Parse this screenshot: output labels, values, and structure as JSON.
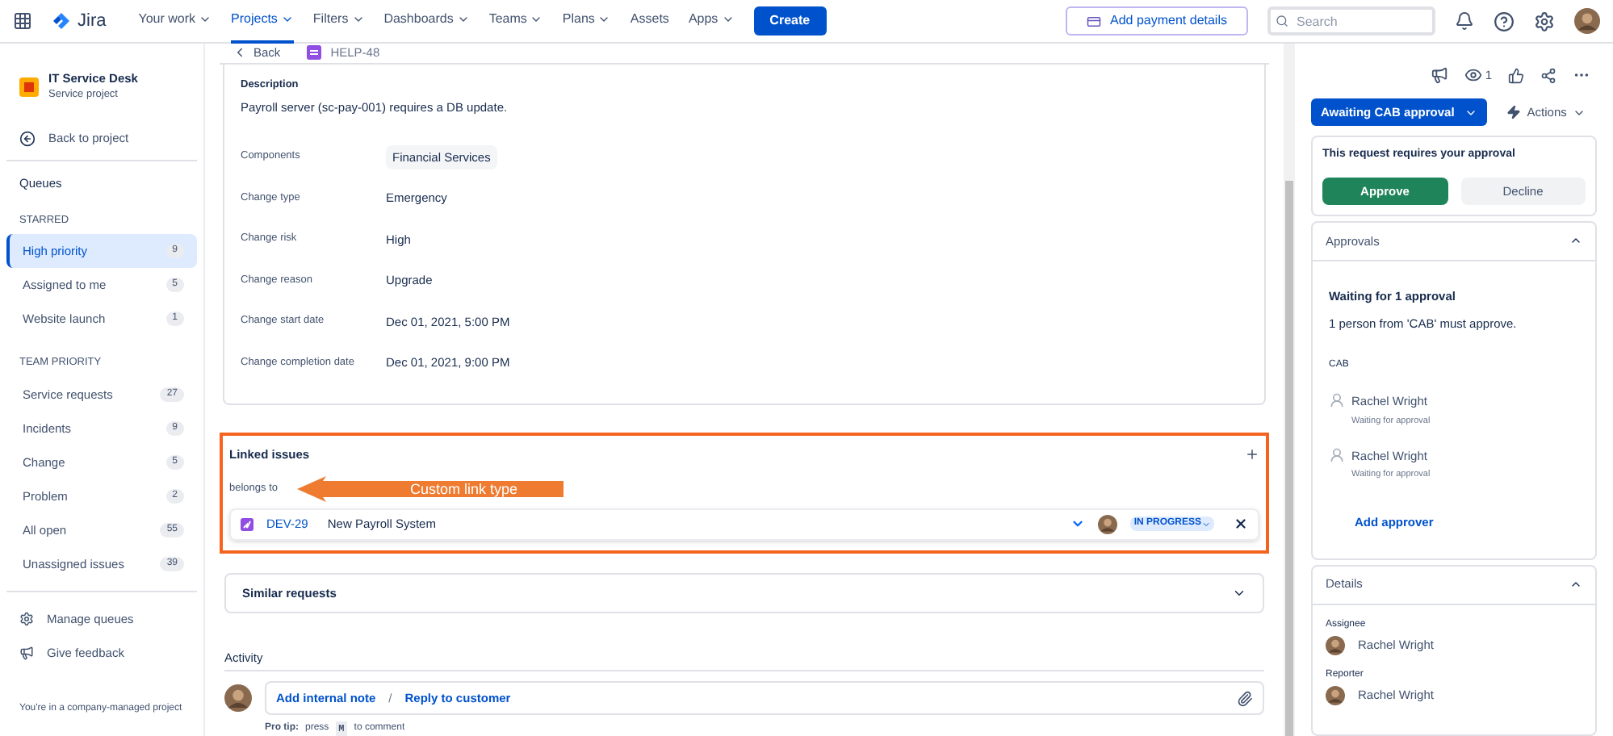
{
  "top_nav": {
    "logo": "Jira",
    "menus": [
      {
        "label": "Your work",
        "selected": false,
        "dropdown": true
      },
      {
        "label": "Projects",
        "selected": true,
        "dropdown": true
      },
      {
        "label": "Filters",
        "selected": false,
        "dropdown": true
      },
      {
        "label": "Dashboards",
        "selected": false,
        "dropdown": true
      },
      {
        "label": "Teams",
        "selected": false,
        "dropdown": true
      },
      {
        "label": "Plans",
        "selected": false,
        "dropdown": true
      },
      {
        "label": "Assets",
        "selected": false,
        "dropdown": false
      },
      {
        "label": "Apps",
        "selected": false,
        "dropdown": true
      }
    ],
    "create": "Create",
    "payment": "Add payment details",
    "search": {
      "placeholder": "Search"
    }
  },
  "sidebar": {
    "project": {
      "name": "IT Service Desk",
      "type": "Service project"
    },
    "back": "Back to project",
    "queues": "Queues",
    "sections": [
      {
        "title": "STARRED",
        "items": [
          {
            "label": "High priority",
            "count": "9",
            "selected": true
          },
          {
            "label": "Assigned to me",
            "count": "5",
            "selected": false
          },
          {
            "label": "Website launch",
            "count": "1",
            "selected": false
          }
        ]
      },
      {
        "title": "TEAM PRIORITY",
        "items": [
          {
            "label": "Service requests",
            "count": "27",
            "selected": false
          },
          {
            "label": "Incidents",
            "count": "9",
            "selected": false
          },
          {
            "label": "Change",
            "count": "5",
            "selected": false
          },
          {
            "label": "Problem",
            "count": "2",
            "selected": false
          },
          {
            "label": "All open",
            "count": "55",
            "selected": false
          },
          {
            "label": "Unassigned issues",
            "count": "39",
            "selected": false
          }
        ]
      }
    ],
    "actions": [
      {
        "kind": "gear",
        "label": "Manage queues"
      },
      {
        "kind": "megaphone",
        "label": "Give feedback"
      }
    ],
    "footer": "You're in a company-managed project"
  },
  "breadcrumb": {
    "back": "Back",
    "issue_key": "HELP-48"
  },
  "description": {
    "label": "Description",
    "text": "Payroll server (sc-pay-001) requires a DB update."
  },
  "fields": [
    {
      "label": "Components",
      "value": "Financial Services",
      "kind": "tag"
    },
    {
      "label": "Change type",
      "value": "Emergency",
      "kind": "text"
    },
    {
      "label": "Change risk",
      "value": "High",
      "kind": "text"
    },
    {
      "label": "Change reason",
      "value": "Upgrade",
      "kind": "text"
    },
    {
      "label": "Change start date",
      "value": "Dec 01, 2021, 5:00 PM",
      "kind": "text"
    },
    {
      "label": "Change completion date",
      "value": "Dec 01, 2021, 9:00 PM",
      "kind": "text"
    }
  ],
  "linked_issues": {
    "title": "Linked issues",
    "link_type": "belongs to",
    "annotation": "Custom link type",
    "issues": [
      {
        "key": "DEV-29",
        "summary": "New Payroll System",
        "status": "IN PROGRESS"
      }
    ]
  },
  "similar_requests": {
    "title": "Similar requests",
    "expanded": false
  },
  "activity": {
    "title": "Activity",
    "add_note": "Add internal note",
    "separator": "/",
    "reply": "Reply to customer",
    "tip_label": "Pro tip:",
    "tip_pre": "press",
    "tip_key": "M",
    "tip_post": "to comment"
  },
  "right_panel": {
    "watchers": "1",
    "status": "Awaiting CAB approval",
    "actions": "Actions",
    "approval_prompt": "This request requires your approval",
    "approve": "Approve",
    "decline": "Decline",
    "approvals": {
      "title": "Approvals",
      "expanded": true,
      "waiting": "Waiting for 1 approval",
      "rule": "1 person from 'CAB' must approve.",
      "group": "CAB",
      "approvers": [
        {
          "name": "Rachel Wright",
          "state": "Waiting for approval"
        },
        {
          "name": "Rachel Wright",
          "state": "Waiting for approval"
        }
      ],
      "add": "Add approver"
    },
    "details": {
      "title": "Details",
      "expanded": true,
      "people": [
        {
          "label": "Assignee",
          "name": "Rachel Wright"
        },
        {
          "label": "Reporter",
          "name": "Rachel Wright"
        }
      ]
    }
  }
}
